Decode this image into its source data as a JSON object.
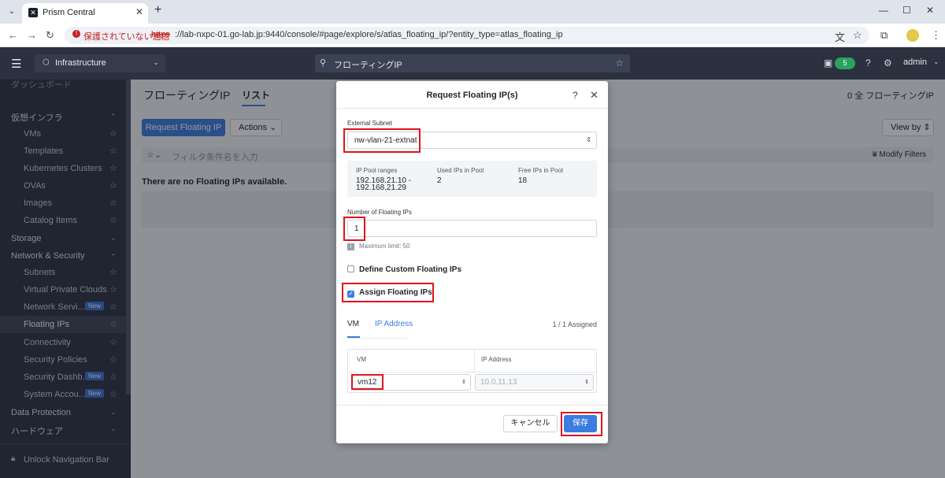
{
  "browser": {
    "tab_title": "Prism Central",
    "insecure_label": "保護されていない通信",
    "url_scheme": "https",
    "url_rest": "://lab-nxpc-01.go-lab.jp:9440/console/#page/explore/s/atlas_floating_ip/?entity_type=atlas_floating_ip"
  },
  "header": {
    "app_selector": "Infrastructure",
    "search_value": "フローティングIP",
    "alert_count": "5",
    "user": "admin"
  },
  "sidebar": {
    "cut_item": "ダッシュボード",
    "groups": {
      "virtual_infra": "仮想インフラ",
      "storage": "Storage",
      "network_security": "Network & Security",
      "data_protection": "Data Protection",
      "hardware": "ハードウェア"
    },
    "items": [
      {
        "label": "VMs"
      },
      {
        "label": "Templates"
      },
      {
        "label": "Kubernetes Clusters"
      },
      {
        "label": "OVAs"
      },
      {
        "label": "Images"
      },
      {
        "label": "Catalog Items"
      },
      {
        "label": "Subnets"
      },
      {
        "label": "Virtual Private Clouds"
      },
      {
        "label": "Network Servi...",
        "badge": "New"
      },
      {
        "label": "Floating IPs"
      },
      {
        "label": "Connectivity"
      },
      {
        "label": "Security Policies"
      },
      {
        "label": "Security Dashb...",
        "badge": "New"
      },
      {
        "label": "System Accou...",
        "badge": "New"
      }
    ],
    "unlock_label": "Unlock Navigation Bar"
  },
  "page": {
    "title": "フローティングIP",
    "tab_list": "リスト",
    "count_label": "0 全 フローティングIP",
    "request_button": "Request Floating IP",
    "actions_button": "Actions",
    "viewby_button": "View by",
    "filter_placeholder": "フィルタ条件名を入力",
    "modify_filters": "Modify Filters",
    "empty_message": "There are no Floating IPs available."
  },
  "modal": {
    "title": "Request Floating IP(s)",
    "external_subnet_label": "External Subnet",
    "external_subnet_value": "nw-vlan-21-extnat",
    "pool_ranges_label": "IP Pool ranges",
    "pool_ranges_value": "192.168.21.10 - 192.168.21.29",
    "used_label": "Used IPs in Pool",
    "used_value": "2",
    "free_label": "Free IPs in Pool",
    "free_value": "18",
    "count_label": "Number of Floating IPs",
    "count_value": "1",
    "max_hint": "Maximum limit: 50",
    "define_custom_label": "Define Custom Floating IPs",
    "assign_label": "Assign Floating IPs",
    "tab_vm": "VM",
    "tab_ip": "IP Address",
    "assigned_label": "1 / 1 Assigned",
    "col_vm": "VM",
    "col_ip": "IP Address",
    "vm_value": "vm12",
    "ip_value": "10.0.11.13",
    "cancel_button": "キャンセル",
    "save_button": "保存"
  },
  "colors": {
    "primary": "#3a7ce0",
    "highlight": "#e0141e",
    "sidebar_bg": "#2c3140"
  }
}
